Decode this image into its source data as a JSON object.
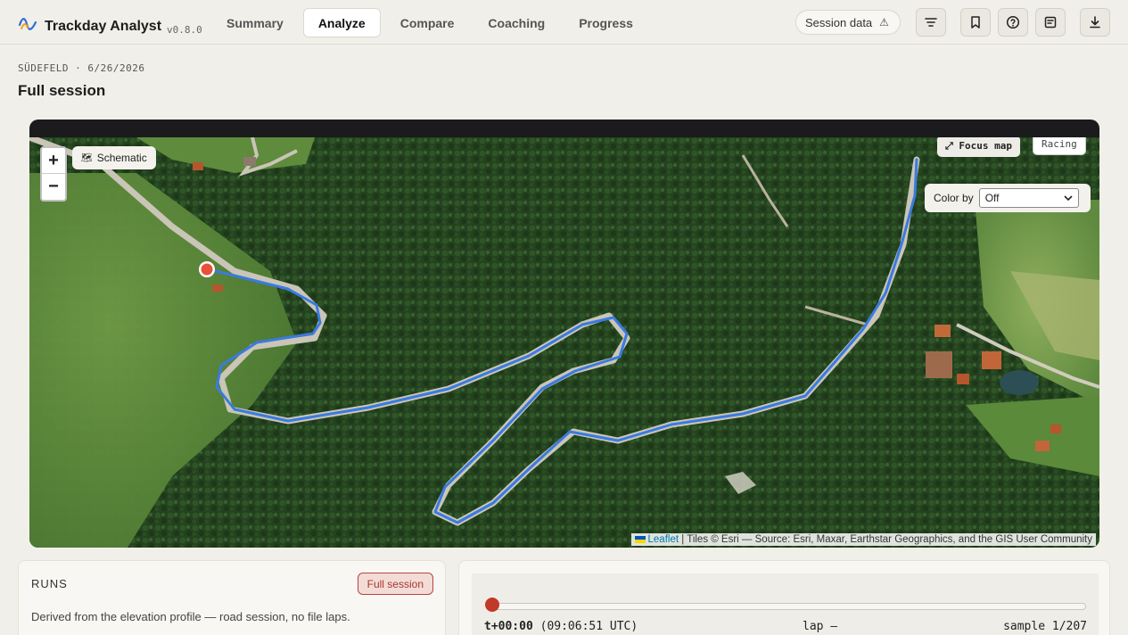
{
  "app": {
    "name": "Trackday Analyst",
    "version": "v0.8.0"
  },
  "tabs": [
    {
      "label": "Summary",
      "active": false
    },
    {
      "label": "Analyze",
      "active": true
    },
    {
      "label": "Compare",
      "active": false
    },
    {
      "label": "Coaching",
      "active": false
    },
    {
      "label": "Progress",
      "active": false
    }
  ],
  "header": {
    "session_data_label": "Session data",
    "session_data_icon": "warning-icon",
    "icons": [
      "filter-icon",
      "bookmark-icon",
      "help-icon",
      "notes-icon",
      "download-icon"
    ]
  },
  "page": {
    "breadcrumb": "SÜDEFELD · 6/26/2026",
    "title": "Full session"
  },
  "map": {
    "zoom_in": "+",
    "zoom_out": "−",
    "schematic_label": "Schematic",
    "schematic_icon": "🗺",
    "focus_label": "⤢ Focus map",
    "racing_label": "Racing",
    "color_by_label": "Color by",
    "color_by_value": "Off",
    "attribution_leaflet": "Leaflet",
    "attribution_text": " | Tiles © Esri — Source: Esri, Maxar, Earthstar Geographics, and the GIS User Community",
    "track_color": "#3a7be0",
    "marker_color": "#e8503a"
  },
  "runs": {
    "title": "RUNS",
    "pill": "Full session",
    "description": "Derived from the elevation profile — road session, no file laps."
  },
  "player": {
    "time": "t+00:00",
    "utc": "(09:06:51 UTC)",
    "lap": "lap –",
    "sample": "sample 1/207",
    "progress": 0.0,
    "accent": "#c0392b"
  }
}
